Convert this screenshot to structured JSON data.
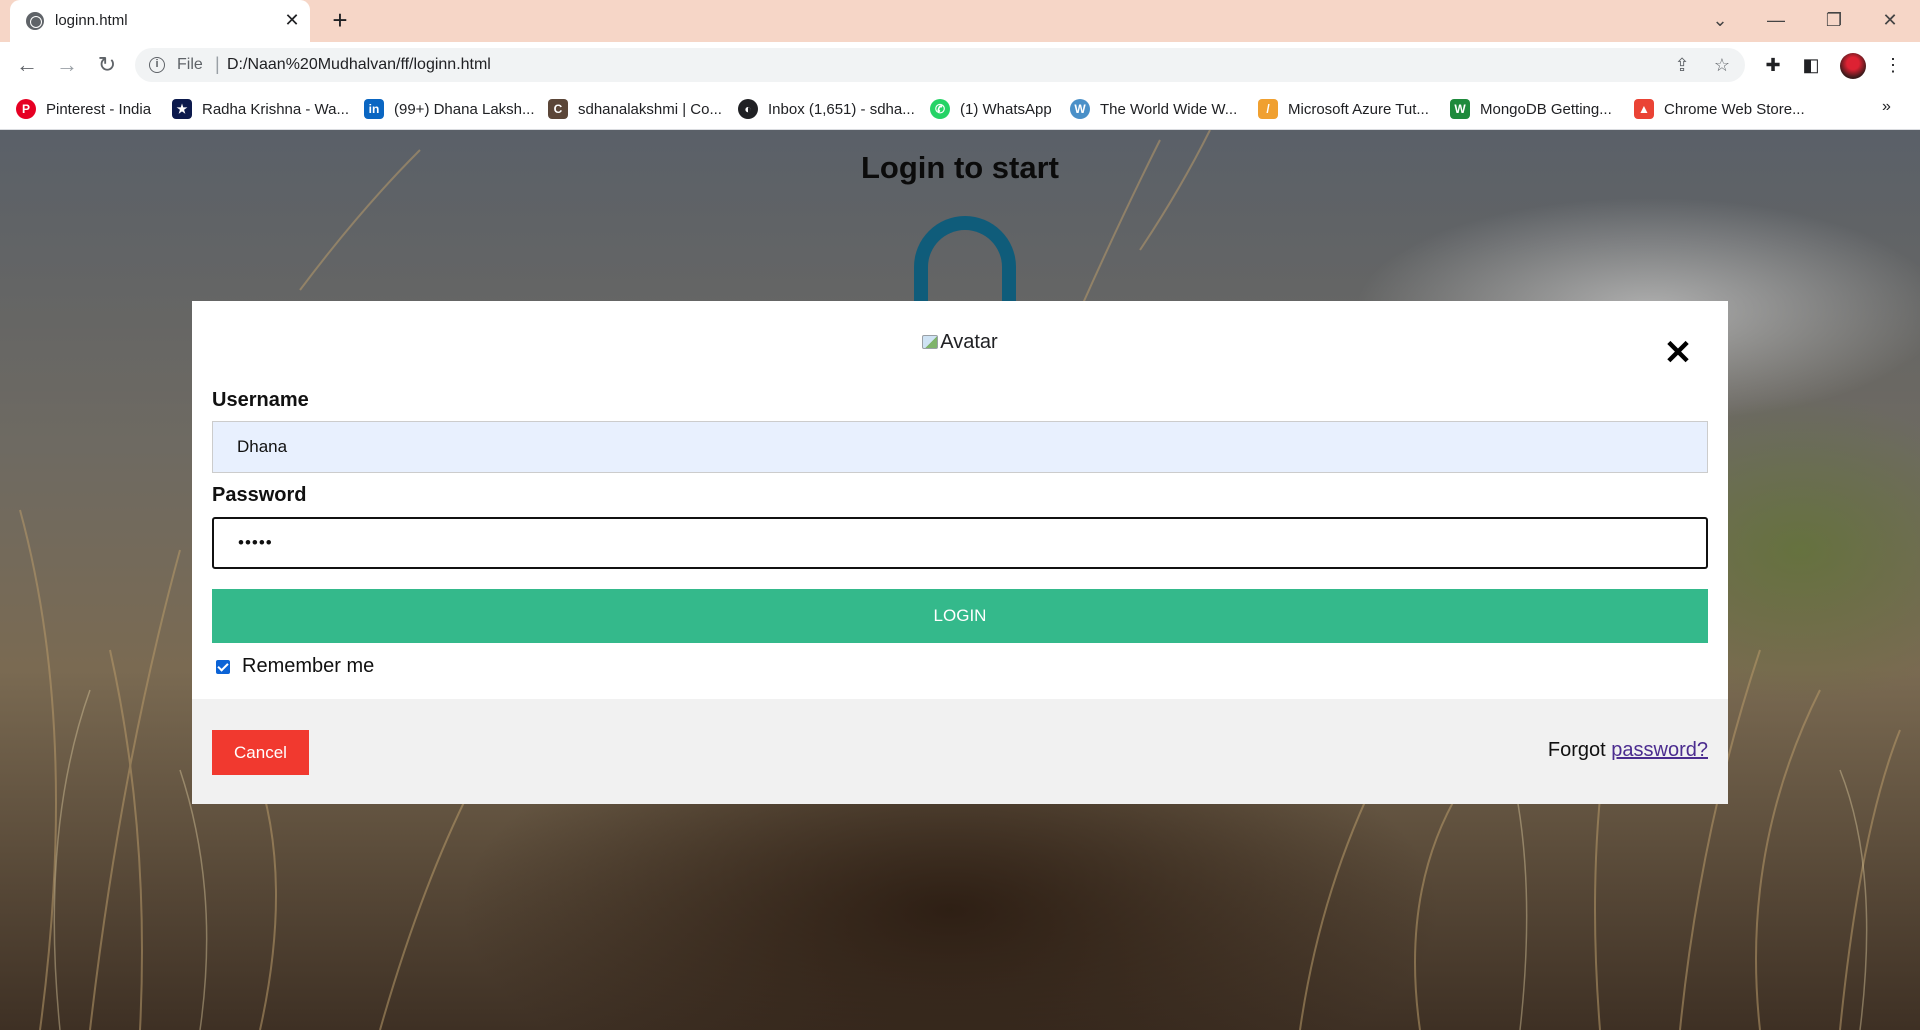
{
  "browser": {
    "tab_title": "loginn.html",
    "url_scheme": "File",
    "url": "D:/Naan%20Mudhalvan/ff/loginn.html",
    "bookmarks": [
      {
        "label": "Pinterest - India",
        "icon": "pinterest-icon",
        "color": "#e60023"
      },
      {
        "label": "Radha Krishna - Wa...",
        "icon": "hotstar-icon",
        "color": "#0c1a4d"
      },
      {
        "label": "(99+) Dhana Laksh...",
        "icon": "linkedin-icon",
        "color": "#0a66c2"
      },
      {
        "label": "sdhanalakshmi | Co...",
        "icon": "codechef-icon",
        "color": "#5b4638"
      },
      {
        "label": "Inbox (1,651) - sdha...",
        "icon": "globe-icon",
        "color": "#202124"
      },
      {
        "label": "(1) WhatsApp",
        "icon": "whatsapp-icon",
        "color": "#25d366"
      },
      {
        "label": "The World Wide W...",
        "icon": "www-icon",
        "color": "#4a90c8"
      },
      {
        "label": "Microsoft Azure Tut...",
        "icon": "azure-icon",
        "color": "#f0a030"
      },
      {
        "label": "MongoDB Getting...",
        "icon": "mongodb-icon",
        "color": "#1e8a3c"
      },
      {
        "label": "Chrome Web Store...",
        "icon": "chrome-webstore-icon",
        "color": "#ea4335"
      }
    ]
  },
  "page": {
    "heading": "Login to start",
    "accent_color": "#0f5c7a"
  },
  "modal": {
    "avatar_alt": "Avatar",
    "username_label": "Username",
    "username_value": "Dhana",
    "password_label": "Password",
    "password_value": "•••••",
    "login_label": "LOGIN",
    "remember_label": "Remember me",
    "remember_checked": true,
    "cancel_label": "Cancel",
    "forgot_prefix": "Forgot ",
    "forgot_link": "password?",
    "colors": {
      "login": "#34b98b",
      "cancel": "#f1392f",
      "link": "#4b2c8f"
    }
  }
}
